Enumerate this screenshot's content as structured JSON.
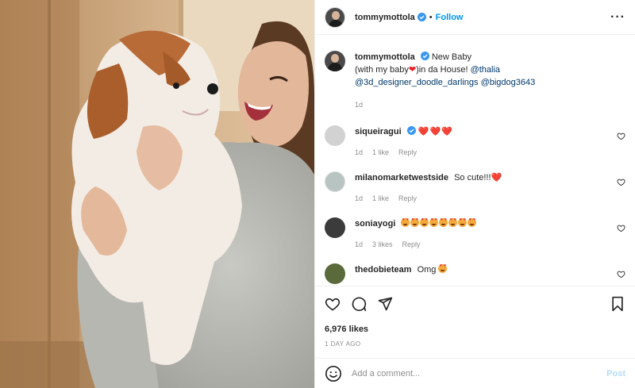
{
  "post": {
    "image_alt": "Woman holding a cream and brown puppy",
    "author": {
      "username": "tommymottola",
      "verified": true,
      "follow_label": "Follow",
      "separator": "•"
    },
    "more_icon": "more-horizontal-icon",
    "caption": {
      "username": "tommymottola",
      "text_1": "New Baby",
      "text_2": "(with my baby",
      "emoji_heart": "❤️",
      "text_3": ")in da House!",
      "mention_1": "@thalia",
      "mention_2": "@3d_designer_doodle_darlings",
      "mention_3": "@bigdog3643",
      "age": "1d"
    },
    "comments": [
      {
        "username": "siqueiragui",
        "verified": true,
        "text": "❤️❤️❤️",
        "age": "1d",
        "likes": "1 like",
        "reply": "Reply",
        "avatar_color": "#c9c9c9"
      },
      {
        "username": "milanomarketwestside",
        "verified": false,
        "text": "So cute!!!",
        "emoji": "❤️",
        "age": "1d",
        "likes": "1 like",
        "reply": "Reply",
        "avatar_color": "#9aa7a4"
      },
      {
        "username": "soniayogi",
        "verified": false,
        "emoji_count": 8,
        "age": "1d",
        "likes": "3 likes",
        "reply": "Reply",
        "avatar_color": "#3b3b3b"
      },
      {
        "username": "thedobieteam",
        "verified": false,
        "text": "Omg",
        "emoji_count": 1,
        "avatar_color": "#5b6a3a"
      }
    ],
    "actions": {
      "icons": [
        "heart-icon",
        "comment-icon",
        "share-icon",
        "bookmark-icon"
      ]
    },
    "likes": "6,976 likes",
    "timestamp": "1 DAY AGO",
    "add_comment": {
      "placeholder": "Add a comment...",
      "post_label": "Post"
    },
    "colors": {
      "link_blue": "#0095f6",
      "mention_blue": "#00376b",
      "muted": "#8e8e8e",
      "post_disabled": "#b3dbff",
      "heart_red": "#ed1c24"
    }
  }
}
